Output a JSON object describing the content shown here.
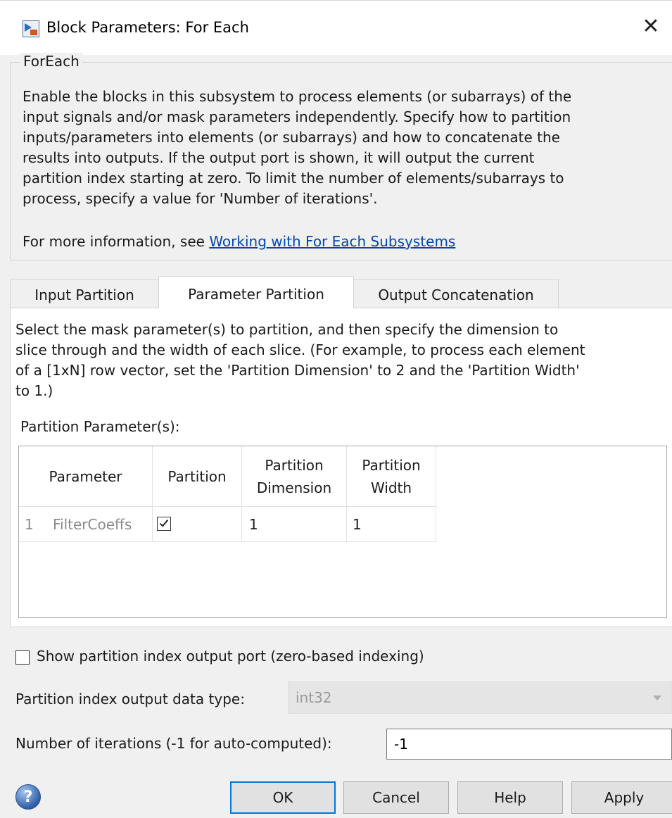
{
  "window": {
    "title": "Block Parameters: For Each",
    "close_symbol": "✕"
  },
  "group": {
    "legend": "ForEach",
    "description": "Enable the blocks in this subsystem to process elements (or subarrays) of the\ninput signals and/or mask parameters independently. Specify how to partition\ninputs/parameters into elements (or subarrays) and how to concatenate the\nresults into outputs. If the output port is shown, it will output the current\npartition index starting at zero.  To limit the number of elements/subarrays to\nprocess, specify a value for 'Number of iterations'.",
    "more_info_prefix": "For more information, see",
    "more_info_link": "Working with For Each Subsystems"
  },
  "tabs": [
    {
      "label": "Input Partition",
      "active": false
    },
    {
      "label": "Parameter Partition",
      "active": true
    },
    {
      "label": "Output Concatenation",
      "active": false
    }
  ],
  "parameter_partition": {
    "description": "Select the mask parameter(s) to partition, and then specify the dimension to\nslice through and the width of each slice. (For example, to process each element\nof a [1xN] row vector, set the 'Partition Dimension' to 2 and the 'Partition Width'\nto 1.)",
    "table_label": "Partition Parameter(s):",
    "columns": [
      "Parameter",
      "Partition",
      "Partition\nDimension",
      "Partition\nWidth"
    ],
    "rows": [
      {
        "index": "1",
        "parameter": "FilterCoeffs",
        "partition": true,
        "dimension": "1",
        "width": "1"
      }
    ]
  },
  "options": {
    "show_index_port_label": "Show partition index output port (zero-based indexing)",
    "show_index_port_checked": false,
    "dtype_label": "Partition index output data type:",
    "dtype_value": "int32",
    "dtype_enabled": false,
    "iterations_label": "Number of iterations (-1 for auto-computed):",
    "iterations_value": "-1"
  },
  "buttons": {
    "help_icon": "?",
    "ok": "OK",
    "cancel": "Cancel",
    "help": "Help",
    "apply": "Apply"
  },
  "colors": {
    "link": "#0645ad",
    "default_button_border": "#0078d7",
    "help_icon": "#2f5fa8"
  },
  "icons": [
    "simulink-block-icon",
    "close-icon",
    "checkbox-checked-icon",
    "checkbox-empty-icon",
    "dropdown-arrow-icon",
    "help-question-icon"
  ]
}
